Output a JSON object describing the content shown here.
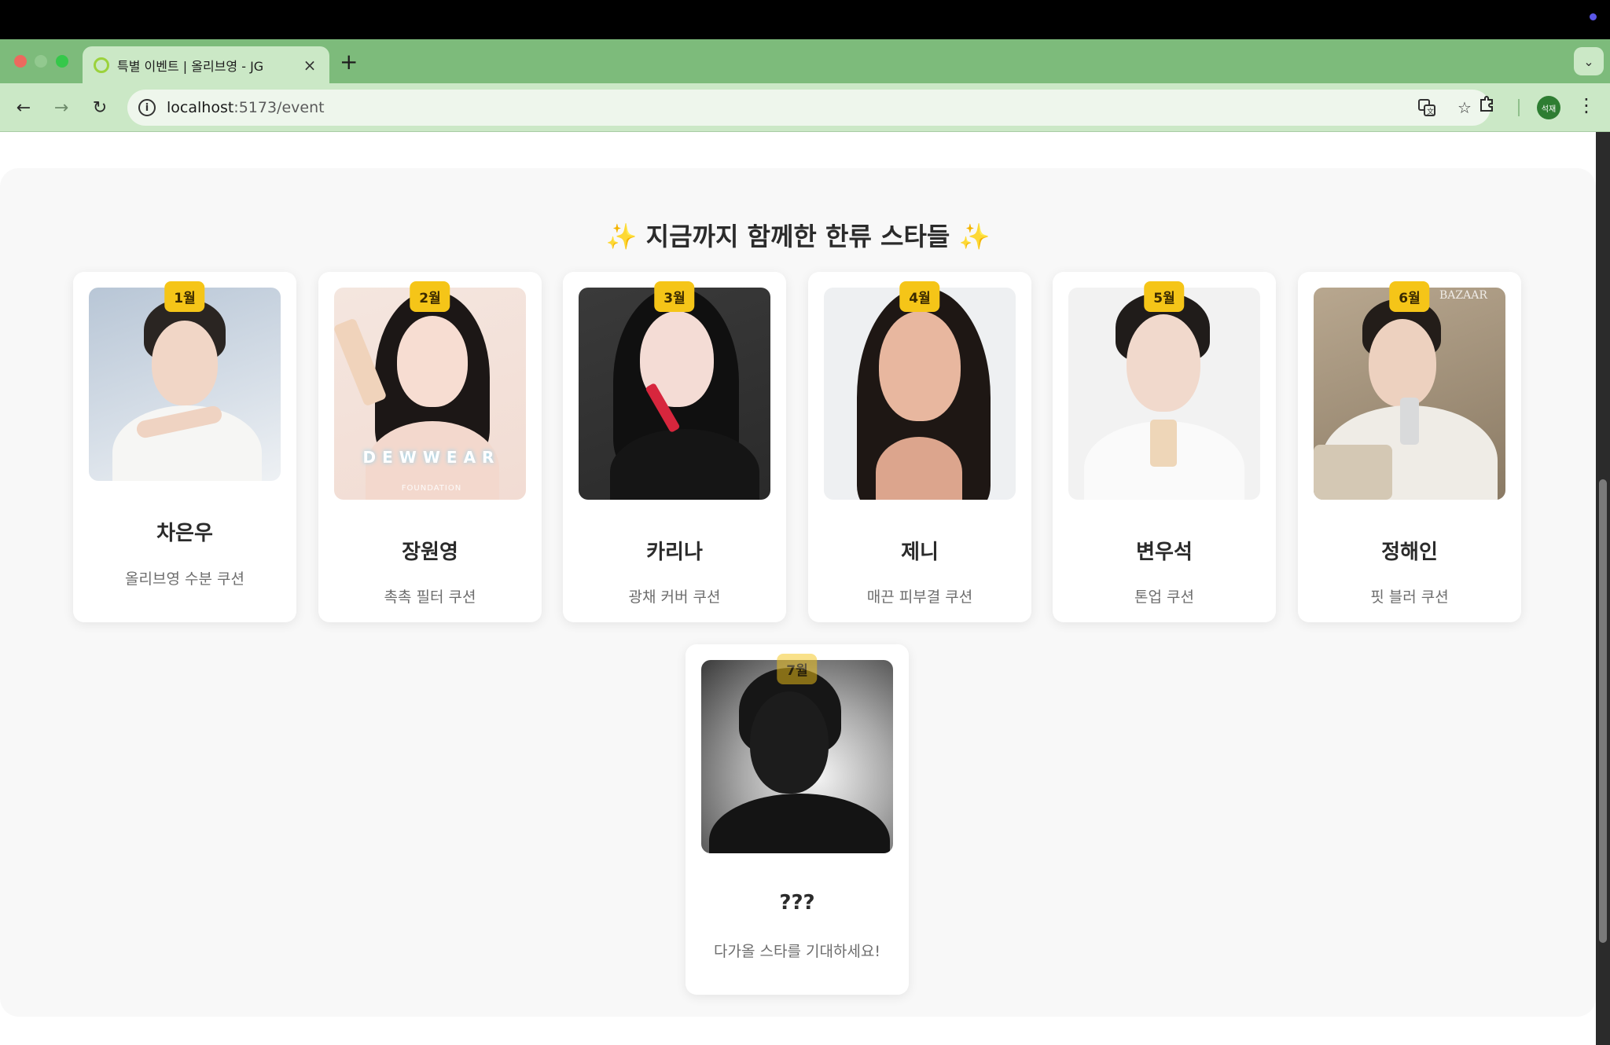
{
  "browser": {
    "tab_title": "특별 이벤트 | 올리브영 - JG",
    "tab_close": "×",
    "new_tab": "+",
    "url_host": "localhost",
    "url_rest": ":5173/event",
    "profile_label": "석재"
  },
  "section": {
    "title_left": "✨",
    "title": "지금까지 함께한 한류 스타들",
    "title_right": "✨"
  },
  "stars": [
    {
      "month": "1월",
      "name": "차은우",
      "coupon": "올리브영 수분 쿠션"
    },
    {
      "month": "2월",
      "name": "장원영",
      "coupon": "촉촉 필터 쿠션",
      "photo_text": "DEWWEAR",
      "photo_subtext": "FOUNDATION"
    },
    {
      "month": "3월",
      "name": "카리나",
      "coupon": "광채 커버 쿠션"
    },
    {
      "month": "4월",
      "name": "제니",
      "coupon": "매끈 피부결 쿠션"
    },
    {
      "month": "5월",
      "name": "변우석",
      "coupon": "톤업 쿠션"
    },
    {
      "month": "6월",
      "name": "정해인",
      "coupon": "핏 블러 쿠션",
      "photo_text": "BAZAAR"
    },
    {
      "month": "7월",
      "name": "???",
      "coupon": "다가올 스타를 기대하세요!"
    }
  ],
  "colors": {
    "badge": "#f5c518",
    "browser_accent": "#7dbb7b",
    "section_bg": "#f8f8f8"
  }
}
